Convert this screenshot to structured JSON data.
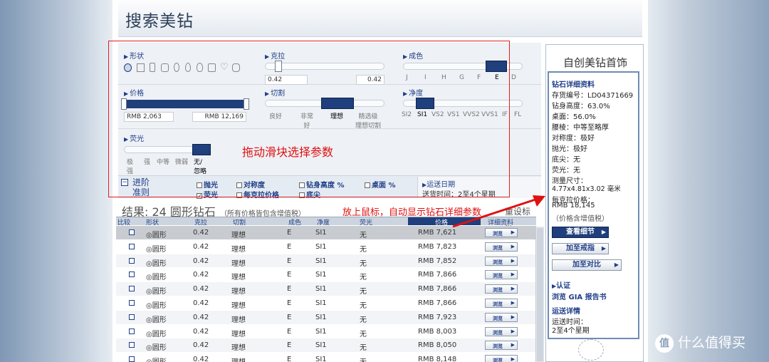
{
  "page": {
    "title": "搜索美钻"
  },
  "filters": {
    "shape": {
      "label": "形状",
      "selected_index": 0
    },
    "carat": {
      "label": "克拉",
      "min": "0.42",
      "max": "0.42"
    },
    "color": {
      "label": "成色",
      "ticks": [
        "J",
        "I",
        "H",
        "G",
        "F",
        "E",
        "D"
      ],
      "selected": "E"
    },
    "price": {
      "label": "价格",
      "min": "RMB 2,063",
      "max": "RMB 12,169"
    },
    "cut": {
      "label": "切割",
      "ticks": [
        "良好",
        "非常\n好",
        "理想",
        "精选级\n理想切割"
      ],
      "selected": "理想"
    },
    "clarity": {
      "label": "净度",
      "ticks": [
        "SI2",
        "SI1",
        "VS2",
        "VS1",
        "VVS2",
        "VVS1",
        "IF",
        "FL"
      ],
      "selected": "SI1"
    },
    "fluor": {
      "label": "荧光",
      "ticks": [
        "极\n强",
        "强",
        "中等",
        "微弱",
        "无/\n忽略"
      ],
      "selected": "无/\n忽略"
    }
  },
  "advanced": {
    "label": "进阶\n准则",
    "toggle": "−",
    "checks": [
      {
        "label": "抛光",
        "checked": false
      },
      {
        "label": "对称度",
        "checked": false
      },
      {
        "label": "钻身高度 %",
        "checked": false
      },
      {
        "label": "桌面 %",
        "checked": false
      },
      {
        "label": "荧光",
        "checked": true
      },
      {
        "label": "每克拉价格",
        "checked": false
      },
      {
        "label": "底尖",
        "checked": false
      }
    ],
    "shipping_label": "运送日期",
    "shipping_value": "送货时间：2至4个星期"
  },
  "annotations": {
    "drag_hint": "拖动滑块选择参数",
    "hover_hint": "放上鼠标，自动显示钻石详细参数"
  },
  "results": {
    "title": "结果:  24 圆形钻石",
    "subtitle": "（所有价格皆包含增值税）",
    "std": "重设标准",
    "headers": [
      "比较",
      "形状",
      "克拉",
      "切割",
      "成色",
      "净度",
      "荧光",
      "价格",
      "详细资料"
    ],
    "view_label": "浏览",
    "rows": [
      {
        "shape": "◎圆形",
        "carat": "0.42",
        "cut": "理想",
        "color": "E",
        "clarity": "SI1",
        "fluor": "无",
        "price": "RMB 7,621"
      },
      {
        "shape": "◎圆形",
        "carat": "0.42",
        "cut": "理想",
        "color": "E",
        "clarity": "SI1",
        "fluor": "无",
        "price": "RMB 7,823"
      },
      {
        "shape": "◎圆形",
        "carat": "0.42",
        "cut": "理想",
        "color": "E",
        "clarity": "SI1",
        "fluor": "无",
        "price": "RMB 7,852"
      },
      {
        "shape": "◎圆形",
        "carat": "0.42",
        "cut": "理想",
        "color": "E",
        "clarity": "SI1",
        "fluor": "无",
        "price": "RMB 7,866"
      },
      {
        "shape": "◎圆形",
        "carat": "0.42",
        "cut": "理想",
        "color": "E",
        "clarity": "SI1",
        "fluor": "无",
        "price": "RMB 7,866"
      },
      {
        "shape": "◎圆形",
        "carat": "0.42",
        "cut": "理想",
        "color": "E",
        "clarity": "SI1",
        "fluor": "无",
        "price": "RMB 7,866"
      },
      {
        "shape": "◎圆形",
        "carat": "0.42",
        "cut": "理想",
        "color": "E",
        "clarity": "SI1",
        "fluor": "无",
        "price": "RMB 7,923"
      },
      {
        "shape": "◎圆形",
        "carat": "0.42",
        "cut": "理想",
        "color": "E",
        "clarity": "SI1",
        "fluor": "无",
        "price": "RMB 8,003"
      },
      {
        "shape": "◎圆形",
        "carat": "0.42",
        "cut": "理想",
        "color": "E",
        "clarity": "SI1",
        "fluor": "无",
        "price": "RMB 8,050"
      },
      {
        "shape": "◎圆形",
        "carat": "0.42",
        "cut": "理想",
        "color": "E",
        "clarity": "SI1",
        "fluor": "无",
        "price": "RMB 8,148"
      }
    ]
  },
  "sidebar": {
    "title": "自创美钻首饰",
    "details": {
      "heading": "钻石详细资料",
      "lines": [
        "存货编号：LD04371669",
        "钻身高度：63.0%",
        "桌面：56.0%",
        "腰棱：中等至略厚",
        "对称度：极好",
        "抛光：极好",
        "底尖：无",
        "荧光：无",
        "测量尺寸：",
        "4.77x4.81x3.02 毫米",
        "每克拉价格：",
        "RMB 18,145",
        "（价格含增值税）"
      ],
      "btn_view": "查看细节",
      "btn_add_ring": "加至戒指",
      "btn_compare": "加至对比",
      "cert_label": "认证",
      "cert_link": "浏览 GIA 报告书",
      "ship_label": "运送详情",
      "ship_value_1": "运送时间：",
      "ship_value_2": "2至4个星期"
    }
  },
  "watermark": {
    "badge": "值",
    "text": "什么值得买"
  }
}
